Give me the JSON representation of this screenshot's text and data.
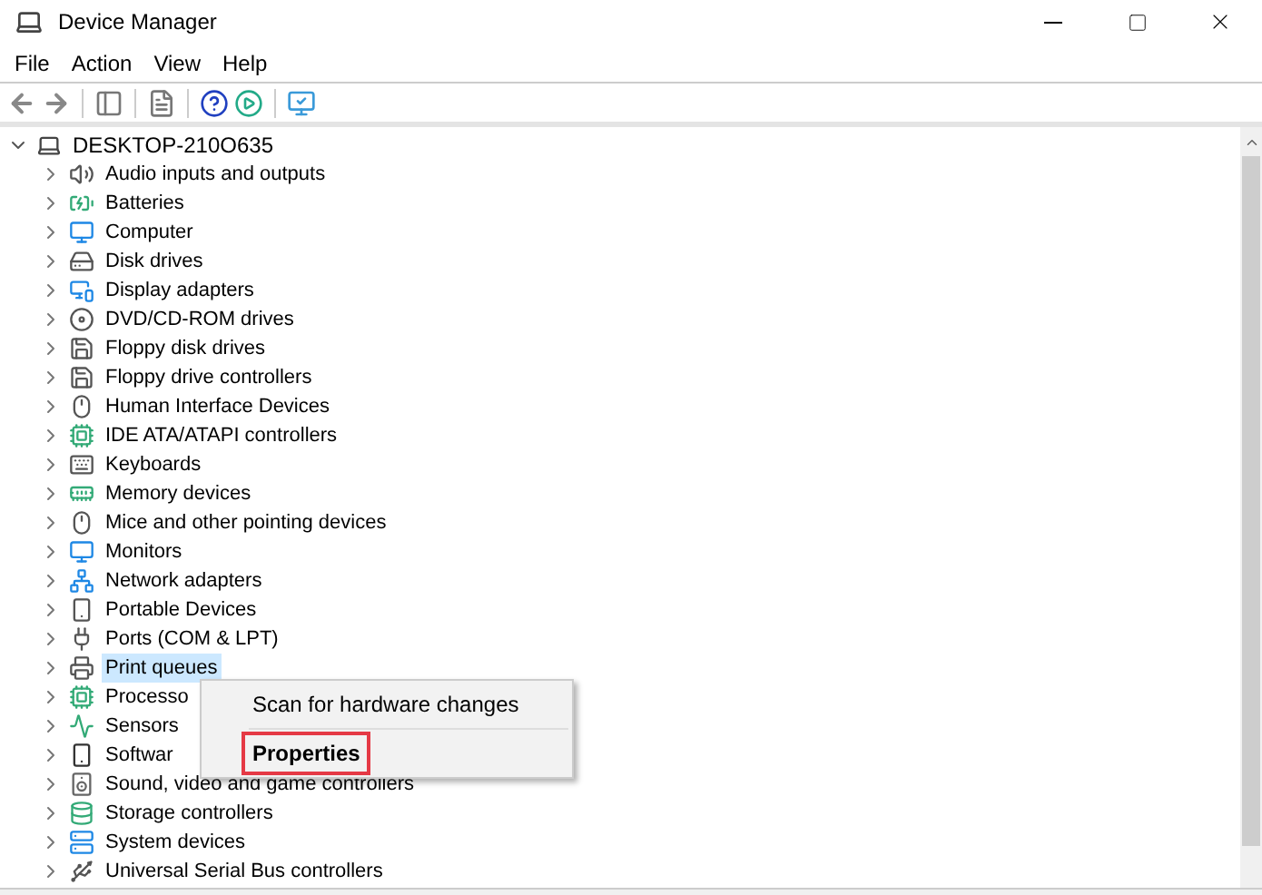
{
  "window": {
    "title": "Device Manager"
  },
  "menu": [
    "File",
    "Action",
    "View",
    "Help"
  ],
  "tree": {
    "label": "DESKTOP-210O635",
    "expanded": true,
    "children": [
      {
        "label": "Audio inputs and outputs",
        "selected": false
      },
      {
        "label": "Batteries",
        "selected": false
      },
      {
        "label": "Computer",
        "selected": false
      },
      {
        "label": "Disk drives",
        "selected": false
      },
      {
        "label": "Display adapters",
        "selected": false
      },
      {
        "label": "DVD/CD-ROM drives",
        "selected": false
      },
      {
        "label": "Floppy disk drives",
        "selected": false
      },
      {
        "label": "Floppy drive controllers",
        "selected": false
      },
      {
        "label": "Human Interface Devices",
        "selected": false
      },
      {
        "label": "IDE ATA/ATAPI controllers",
        "selected": false
      },
      {
        "label": "Keyboards",
        "selected": false
      },
      {
        "label": "Memory devices",
        "selected": false
      },
      {
        "label": "Mice and other pointing devices",
        "selected": false
      },
      {
        "label": "Monitors",
        "selected": false
      },
      {
        "label": "Network adapters",
        "selected": false
      },
      {
        "label": "Portable Devices",
        "selected": false
      },
      {
        "label": "Ports (COM & LPT)",
        "selected": false
      },
      {
        "label": "Print queues",
        "selected": true
      },
      {
        "label": "Processo",
        "selected": false
      },
      {
        "label": "Sensors",
        "selected": false
      },
      {
        "label": "Softwar",
        "selected": false
      },
      {
        "label": "Sound, video and game controllers",
        "selected": false
      },
      {
        "label": "Storage controllers",
        "selected": false
      },
      {
        "label": "System devices",
        "selected": false
      },
      {
        "label": "Universal Serial Bus controllers",
        "selected": false
      }
    ]
  },
  "context_menu": [
    {
      "label": "Scan for hardware changes",
      "highlighted": false
    },
    {
      "label": "Properties",
      "highlighted": true
    }
  ]
}
